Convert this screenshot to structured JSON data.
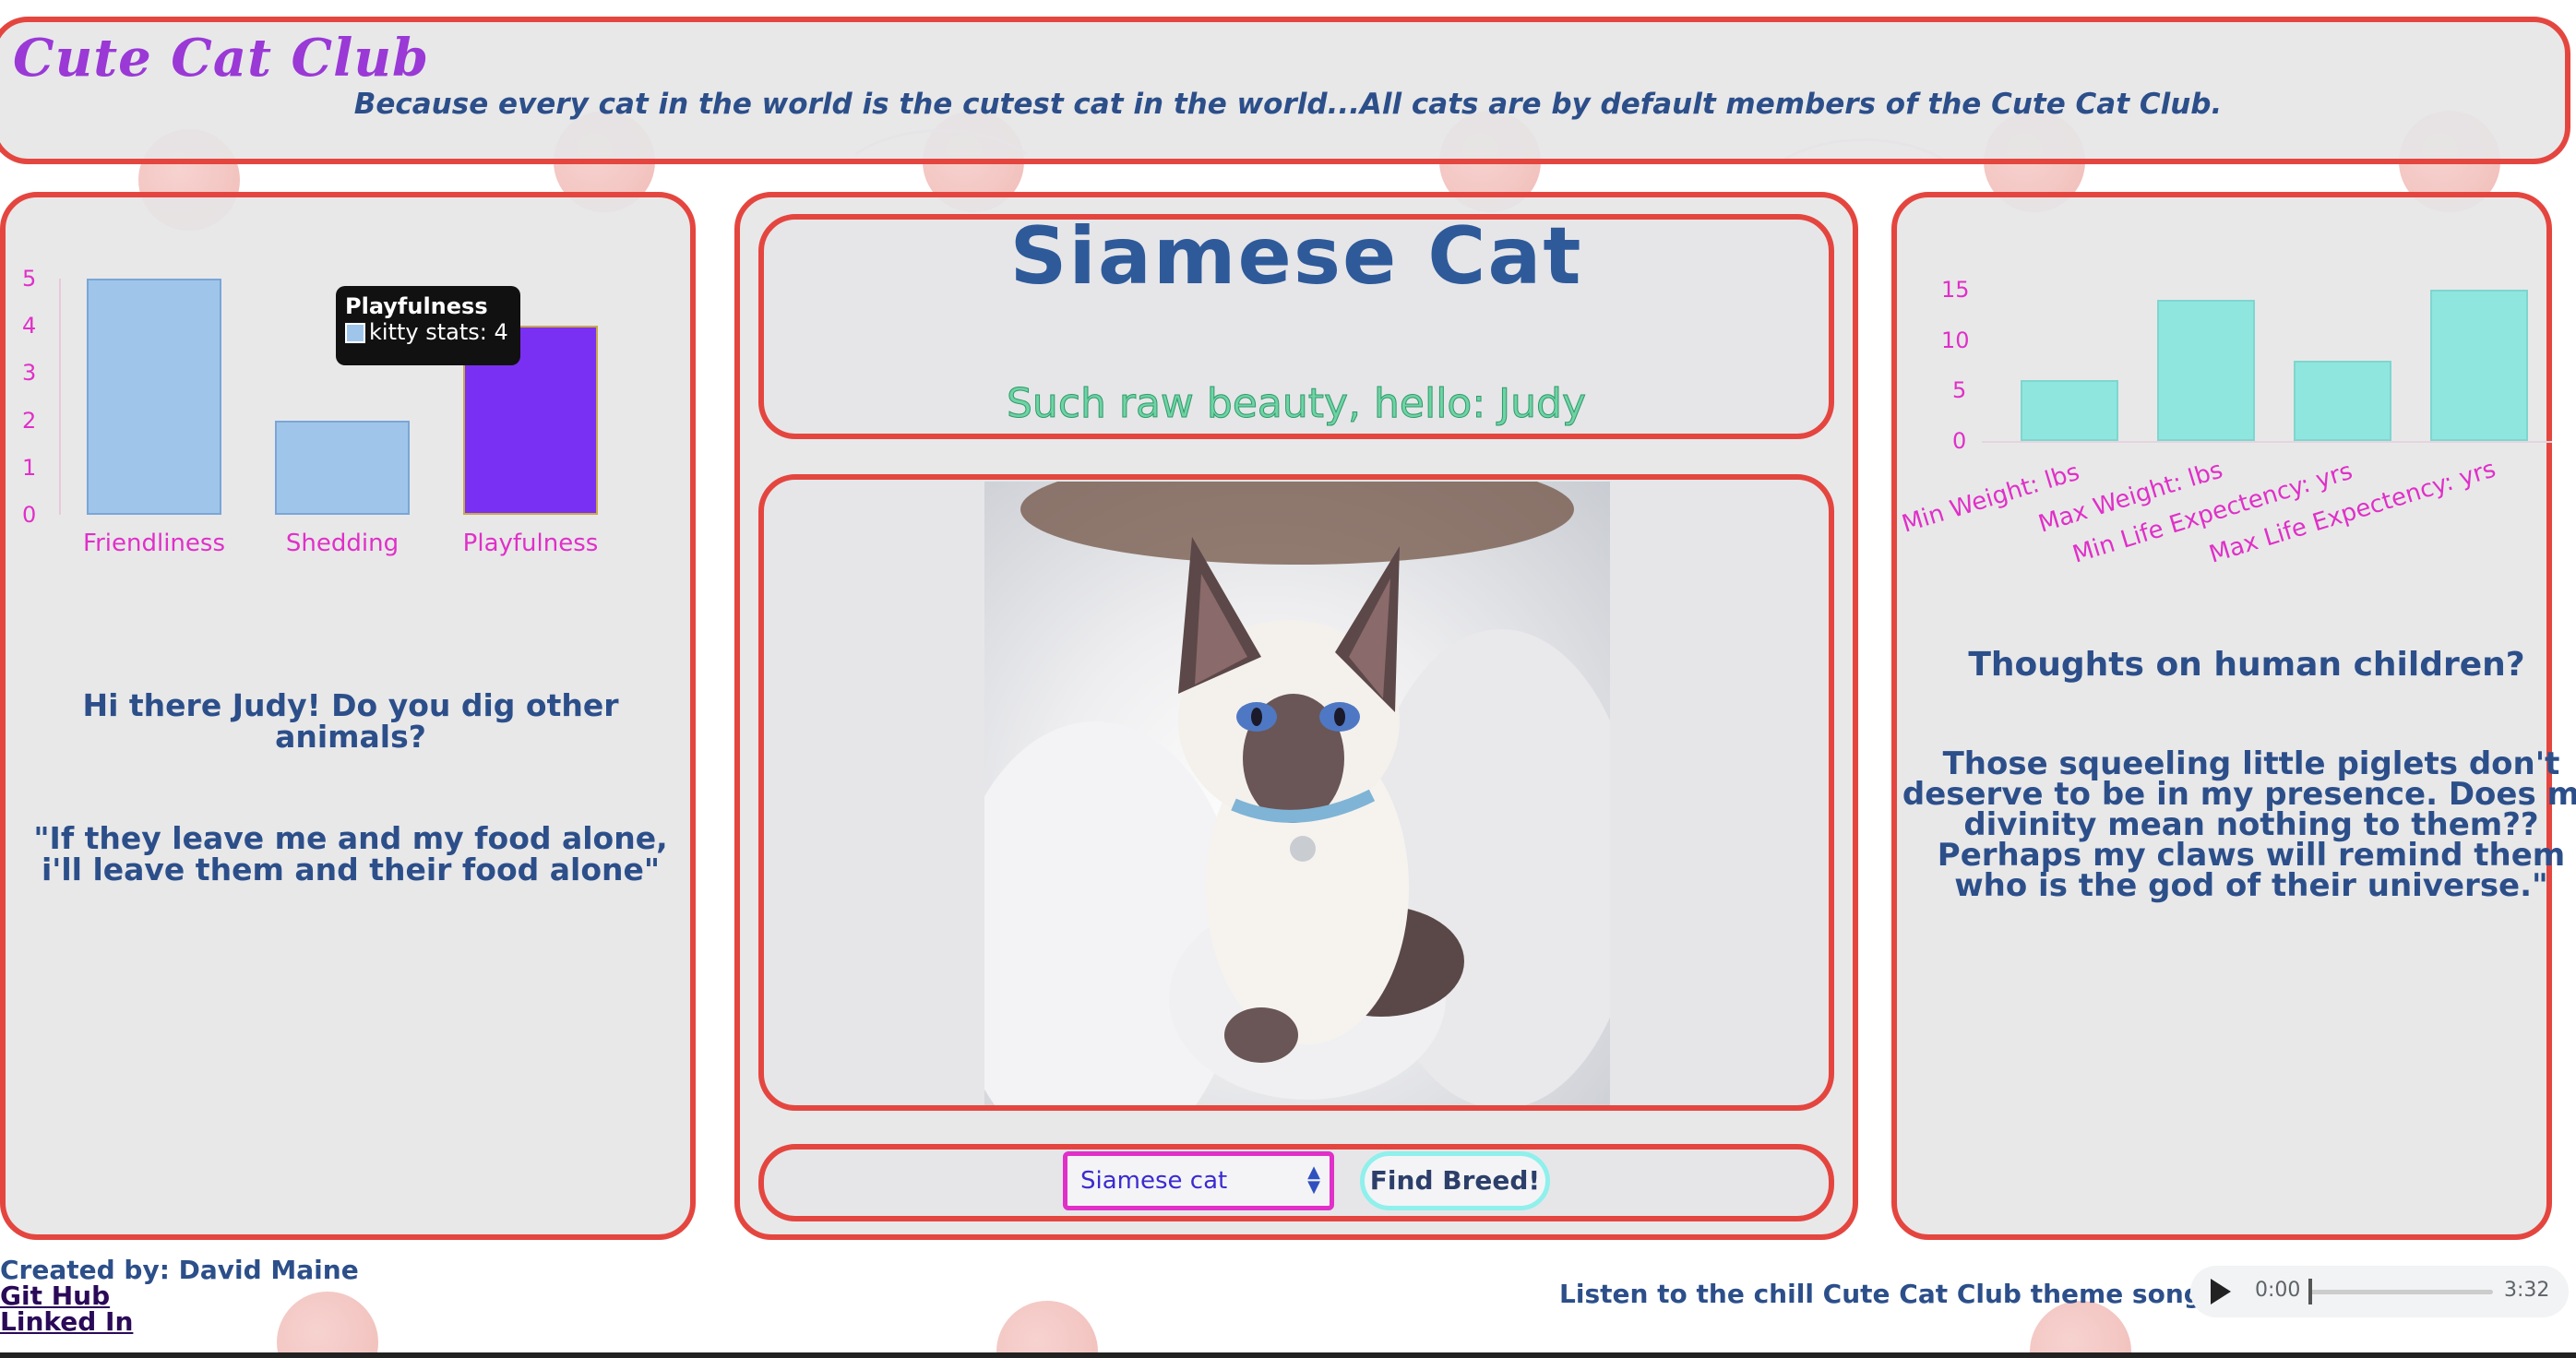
{
  "header": {
    "club_title": "Cute Cat Club",
    "tagline": "Because every cat in the world is the cutest cat in the world...All cats are by default members of the Cute Cat Club."
  },
  "left_panel": {
    "chart": {
      "tooltip_title": "Playfulness",
      "tooltip_value": "kitty stats: 4",
      "highlight_color": "#7a30f2",
      "bar_color": "#9fc6ea"
    },
    "greeting": "Hi there Judy! Do you dig other animals?",
    "quote": "\"If they leave me and my food alone, i'll leave them and their food alone\""
  },
  "center_panel": {
    "breed_name": "Siamese Cat",
    "beauty_line": "Such raw beauty, hello: Judy",
    "photo_alt": "Siamese kitten photo",
    "select_value": "Siamese cat",
    "find_button": "Find Breed!"
  },
  "right_panel": {
    "chart": {
      "bar_color": "#8fe6df"
    },
    "question": "Thoughts on human children?",
    "answer": "Those squeeling little piglets don't deserve to be in my presence. Does my divinity mean nothing to them?? Perhaps my claws will remind them who is the god of their universe.\""
  },
  "footer": {
    "created_by": "Created by: David Maine",
    "github_link": "Git Hub",
    "linkedin_link": "Linked In",
    "listen_text": "Listen to the chill Cute Cat Club theme song! =>",
    "audio_current": "0:00",
    "audio_duration": "3:32"
  },
  "chart_data": [
    {
      "type": "bar",
      "categories": [
        "Friendliness",
        "Shedding",
        "Playfulness"
      ],
      "series": [
        {
          "name": "kitty stats",
          "values": [
            5,
            2,
            4
          ]
        }
      ],
      "ylim": [
        0,
        5
      ],
      "yticks": [
        0,
        1,
        2,
        3,
        4,
        5
      ],
      "grid": false,
      "legend": "none"
    },
    {
      "type": "bar",
      "categories": [
        "Min Weight: lbs",
        "Max Weight: lbs",
        "Min Life Expectency: yrs",
        "Max Life Expectency: yrs"
      ],
      "series": [
        {
          "values": [
            6,
            14,
            8,
            15
          ]
        }
      ],
      "ylim": [
        0,
        15
      ],
      "yticks": [
        0,
        5,
        10,
        15
      ],
      "grid": false,
      "legend": "none"
    }
  ]
}
